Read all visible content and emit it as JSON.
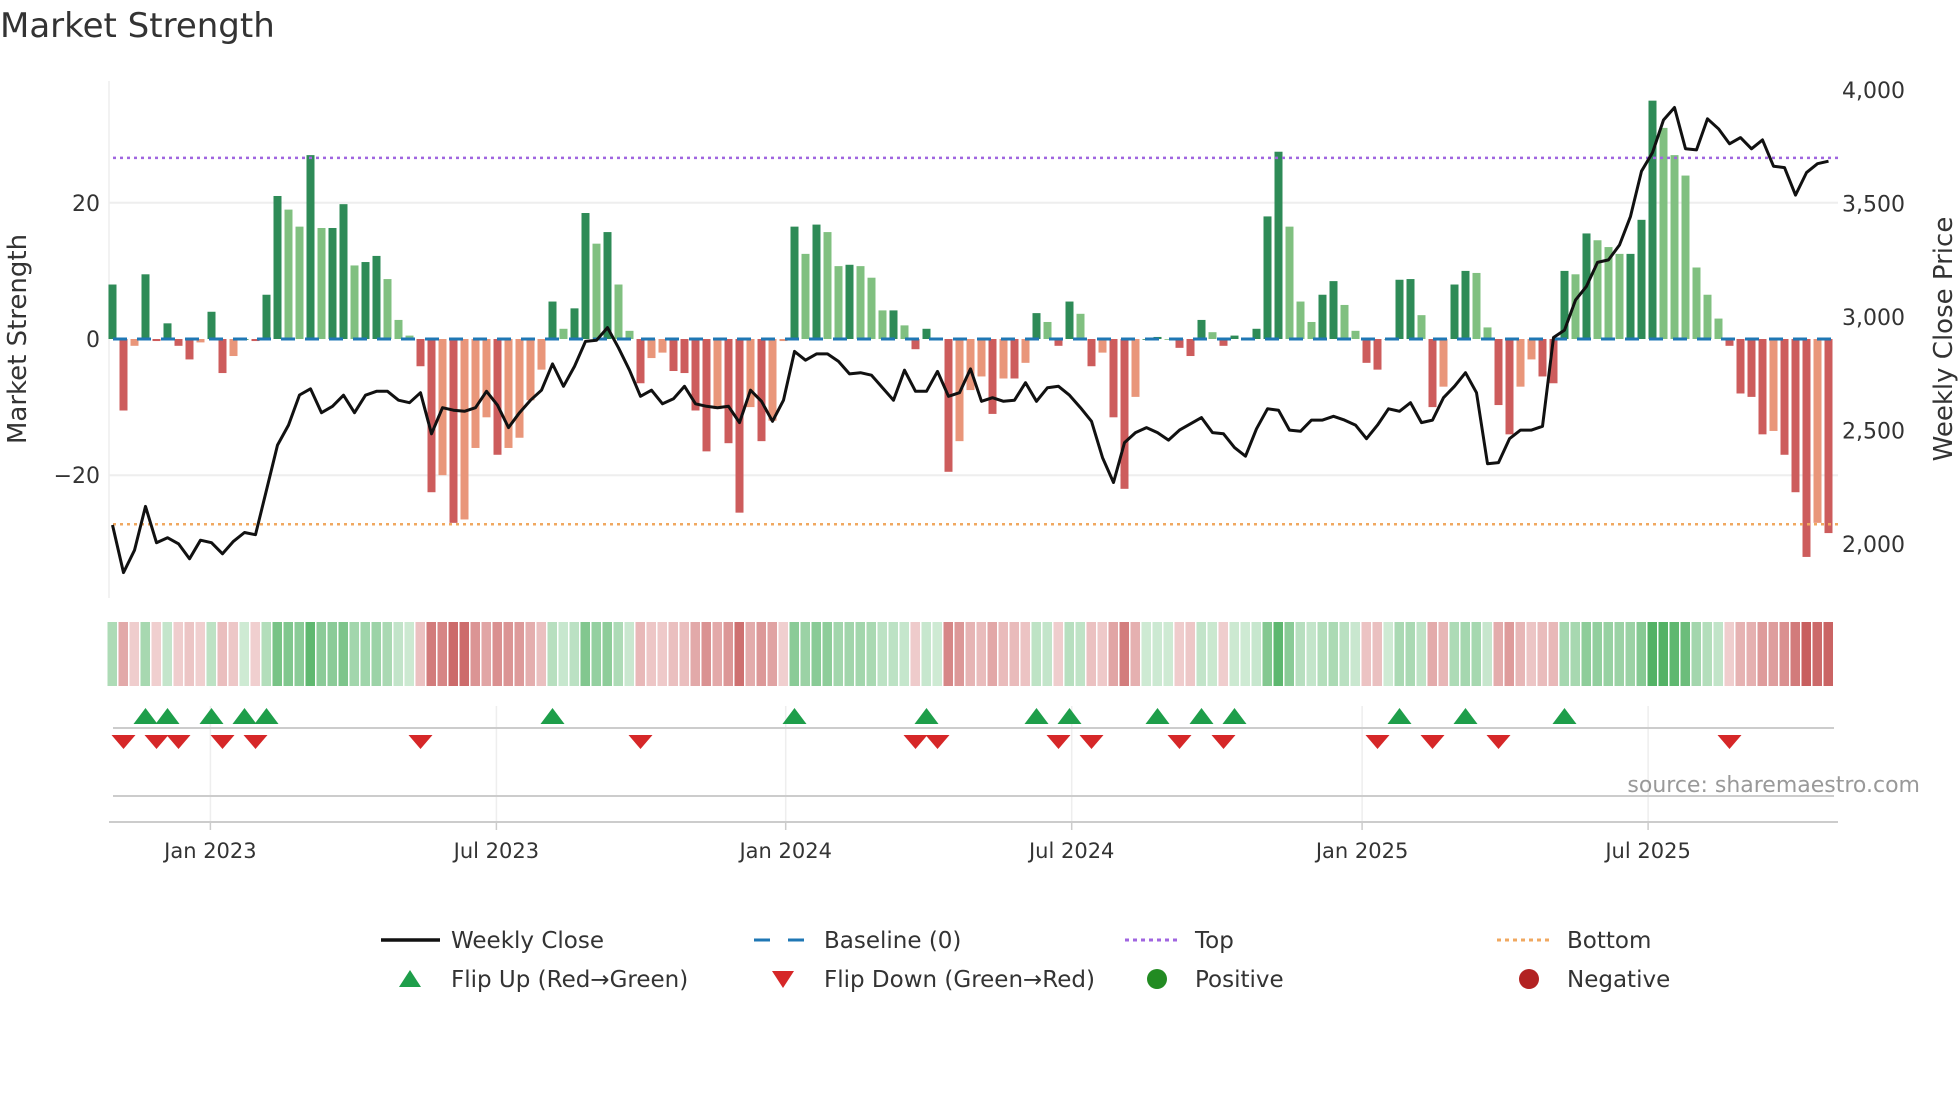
{
  "chart_data": {
    "type": "bar",
    "title": "Market Strength",
    "ylabel": "Market Strength",
    "y2label": "Weekly Close Price",
    "ylim": [
      -35,
      38
    ],
    "y2lim": [
      1800,
      4070
    ],
    "y_ticks": [
      {
        "value": 20,
        "label": "20"
      },
      {
        "value": 0,
        "label": "0"
      },
      {
        "value": -20,
        "label": "−20"
      }
    ],
    "y2_ticks": [
      {
        "value": 4000,
        "label": "4,000"
      },
      {
        "value": 3500,
        "label": "3,500"
      },
      {
        "value": 3000,
        "label": "3,000"
      },
      {
        "value": 2500,
        "label": "2,500"
      },
      {
        "value": 2000,
        "label": "2,000"
      }
    ],
    "x_ticks": [
      {
        "label": "Jan 2023",
        "week": 8.9
      },
      {
        "label": "Jul 2023",
        "week": 34.9
      },
      {
        "label": "Jan 2024",
        "week": 61.2
      },
      {
        "label": "Jul 2024",
        "week": 87.2
      },
      {
        "label": "Jan 2025",
        "week": 113.6
      },
      {
        "label": "Jul 2025",
        "week": 139.6
      }
    ],
    "top_level": 26.6,
    "bottom_level": -27.2,
    "baseline": 0,
    "strength": [
      8,
      -10.5,
      -1,
      9.5,
      -0.3,
      2.3,
      -1,
      -3,
      -0.5,
      4,
      -5,
      -2.5,
      0,
      -0.3,
      6.5,
      21,
      19,
      16.5,
      27,
      16.3,
      16.3,
      19.8,
      10.8,
      11.3,
      12.2,
      8.8,
      2.8,
      0.5,
      -4,
      -22.5,
      -20,
      -27,
      -26.5,
      -16,
      -11.5,
      -17,
      -16,
      -14.5,
      -9,
      -4.5,
      5.5,
      1.5,
      4.5,
      18.5,
      14,
      15.7,
      8,
      1.2,
      -6.5,
      -2.8,
      -2,
      -4.7,
      -5,
      -10.5,
      -16.5,
      -10.3,
      -15.3,
      -25.5,
      -10,
      -15,
      -12,
      -0.3,
      16.5,
      12.5,
      16.8,
      15.7,
      10.7,
      10.9,
      10.7,
      9,
      4.2,
      4.2,
      2,
      -1.5,
      1.5,
      0,
      -19.5,
      -15,
      -7.5,
      -5.5,
      -11,
      -5.8,
      -5.8,
      -3.5,
      3.8,
      2.5,
      -1,
      5.5,
      3.7,
      -4,
      -2,
      -11.5,
      -22,
      -8.5,
      0,
      0.3,
      0,
      -1.3,
      -2.5,
      2.8,
      1,
      -1,
      0.5,
      0,
      1.5,
      18,
      27.5,
      16.5,
      5.5,
      2.5,
      6.5,
      8.5,
      5,
      1.2,
      -3.5,
      -4.5,
      0,
      8.7,
      8.8,
      3.5,
      -10,
      -7,
      8,
      10,
      9.7,
      1.7,
      -9.7,
      -14,
      -7,
      -3,
      -5.5,
      -6.5,
      10,
      9.5,
      15.5,
      14.5,
      13.5,
      12.5,
      12.5,
      17.5,
      35,
      31,
      27,
      24,
      10.5,
      6.5,
      3,
      -1,
      -8,
      -8.5,
      -14,
      -13.5,
      -17,
      -22.5,
      -32,
      -27,
      -28.5
    ],
    "weekly_close": [
      2083,
      1873,
      1972,
      2165,
      2005,
      2027,
      2000,
      1934,
      2016,
      2005,
      1956,
      2011,
      2050,
      2040,
      2237,
      2435,
      2523,
      2656,
      2683,
      2578,
      2606,
      2655,
      2578,
      2655,
      2672,
      2672,
      2633,
      2622,
      2666,
      2485,
      2600,
      2589,
      2584,
      2600,
      2672,
      2611,
      2512,
      2578,
      2633,
      2677,
      2793,
      2694,
      2782,
      2892,
      2897,
      2953,
      2864,
      2765,
      2650,
      2677,
      2617,
      2639,
      2694,
      2617,
      2606,
      2600,
      2606,
      2534,
      2677,
      2628,
      2540,
      2633,
      2848,
      2809,
      2837,
      2837,
      2804,
      2749,
      2754,
      2743,
      2688,
      2633,
      2765,
      2672,
      2672,
      2760,
      2650,
      2666,
      2771,
      2628,
      2644,
      2628,
      2633,
      2710,
      2628,
      2688,
      2694,
      2655,
      2600,
      2540,
      2380,
      2270,
      2446,
      2490,
      2512,
      2490,
      2457,
      2501,
      2529,
      2556,
      2490,
      2485,
      2424,
      2386,
      2507,
      2595,
      2589,
      2501,
      2496,
      2545,
      2545,
      2562,
      2545,
      2523,
      2463,
      2523,
      2595,
      2584,
      2622,
      2534,
      2545,
      2644,
      2694,
      2754,
      2666,
      2353,
      2358,
      2463,
      2501,
      2501,
      2518,
      2909,
      2942,
      3074,
      3135,
      3240,
      3251,
      3317,
      3443,
      3642,
      3724,
      3868,
      3923,
      3741,
      3736,
      3873,
      3829,
      3763,
      3790,
      3741,
      3780,
      3664,
      3658,
      3537,
      3636,
      3675,
      3686
    ],
    "flip_up_weeks": [
      3,
      5,
      9,
      12,
      14,
      40,
      62,
      74,
      84,
      87,
      95,
      99,
      102,
      117,
      123,
      132
    ],
    "flip_down_weeks": [
      1,
      4,
      6,
      10,
      13,
      28,
      48,
      73,
      75,
      86,
      89,
      97,
      101,
      115,
      120,
      126,
      147
    ],
    "legend": [
      {
        "label": "Weekly Close",
        "symbol": "solid-line",
        "color": "#111111"
      },
      {
        "label": "Baseline (0)",
        "symbol": "dashed-line",
        "color": "#1f77b4"
      },
      {
        "label": "Top",
        "symbol": "dotted-line",
        "color": "#a066e0"
      },
      {
        "label": "Bottom",
        "symbol": "dotted-line",
        "color": "#f0a860"
      },
      {
        "label": "Flip Up (Red→Green)",
        "symbol": "triangle-up",
        "color": "#1e9e4a"
      },
      {
        "label": "Flip Down (Green→Red)",
        "symbol": "triangle-down",
        "color": "#d62728"
      },
      {
        "label": "Positive",
        "symbol": "circle",
        "color": "#228b22"
      },
      {
        "label": "Negative",
        "symbol": "circle",
        "color": "#b22222"
      }
    ],
    "legend_position": "bottom",
    "source": "source: sharemaestro.com",
    "colors": {
      "pos_strong": "#2e8b57",
      "pos_weak": "#80c080",
      "neg_strong": "#cd5c5c",
      "neg_weak": "#e9967a"
    }
  }
}
